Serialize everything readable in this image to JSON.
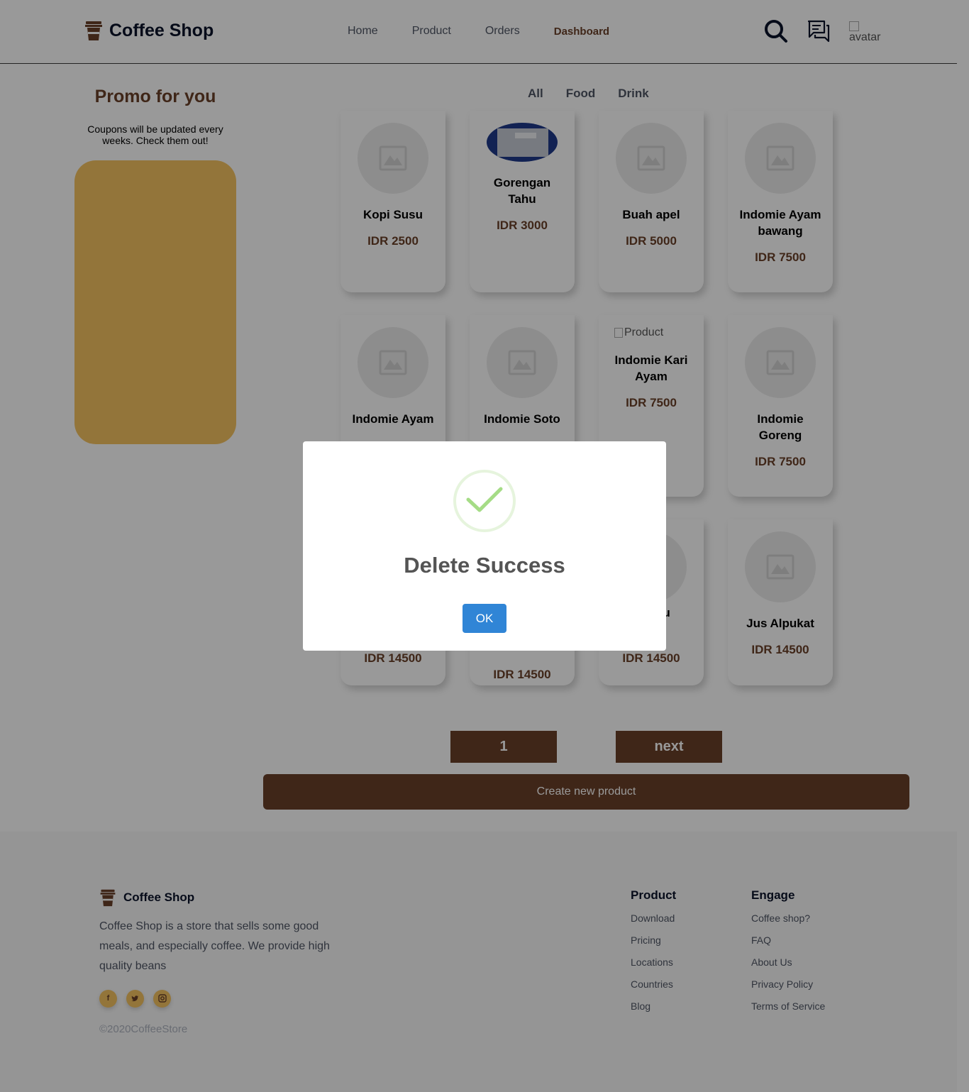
{
  "header": {
    "brand": "Coffee Shop",
    "nav": [
      "Home",
      "Product",
      "Orders",
      "Dashboard"
    ],
    "active_nav": "Dashboard",
    "avatar_alt": "avatar"
  },
  "promo": {
    "title": "Promo for you",
    "subtitle": "Coupons will be updated every weeks. Check them out!"
  },
  "categories": [
    "All",
    "Food",
    "Drink"
  ],
  "products": [
    {
      "name": "Kopi Susu",
      "price": "IDR 2500",
      "image": "placeholder"
    },
    {
      "name": "Gorengan Tahu",
      "price": "IDR 3000",
      "image": "photo"
    },
    {
      "name": "Buah apel",
      "price": "IDR 5000",
      "image": "placeholder"
    },
    {
      "name": "Indomie Ayam bawang",
      "price": "IDR 7500",
      "image": "placeholder"
    },
    {
      "name": "Indomie Ayam",
      "price": "",
      "image": "placeholder"
    },
    {
      "name": "Indomie Soto",
      "price": "",
      "image": "placeholder"
    },
    {
      "name": "Indomie Kari Ayam",
      "price": "IDR 7500",
      "image": "broken",
      "alt": "Product"
    },
    {
      "name": "Indomie Goreng",
      "price": "IDR 7500",
      "image": "placeholder"
    },
    {
      "name": "",
      "price": "IDR 14500",
      "image": "placeholder"
    },
    {
      "name": "",
      "price": "IDR 14500",
      "image": "placeholder"
    },
    {
      "name": "bu",
      "price": "IDR 14500",
      "image": "placeholder"
    },
    {
      "name": "Jus Alpukat",
      "price": "IDR 14500",
      "image": "placeholder"
    }
  ],
  "pagination": {
    "current": "1",
    "next": "next"
  },
  "create_button": "Create new product",
  "footer": {
    "brand": "Coffee Shop",
    "description": "Coffee Shop is a store that sells some good meals, and especially coffee. We provide high quality beans",
    "socials": [
      "facebook-icon",
      "twitter-icon",
      "instagram-icon"
    ],
    "copyright": "©2020CoffeeStore",
    "columns": [
      {
        "title": "Product",
        "links": [
          "Download",
          "Pricing",
          "Locations",
          "Countries",
          "Blog"
        ]
      },
      {
        "title": "Engage",
        "links": [
          "Coffee shop?",
          "FAQ",
          "About Us",
          "Privacy Policy",
          "Terms of Service"
        ]
      }
    ]
  },
  "modal": {
    "title": "Delete Success",
    "button": "OK"
  },
  "colors": {
    "brand": "#6a4029",
    "promo": "#f5c361",
    "ok_button": "#3085d6",
    "success": "#a5dc86"
  }
}
